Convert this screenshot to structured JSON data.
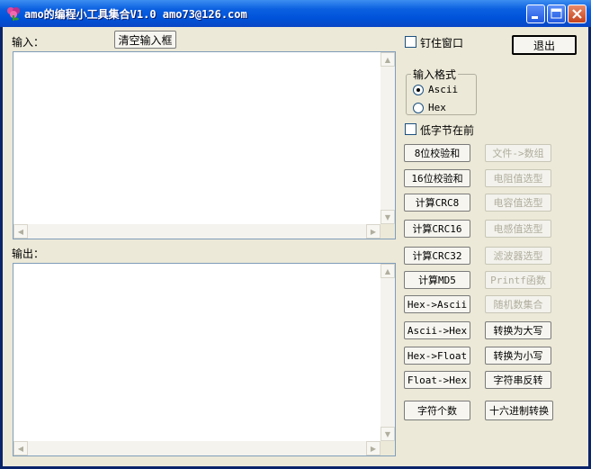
{
  "window": {
    "title": "amo的编程小工具集合V1.0  amo73@126.com"
  },
  "input_section": {
    "label": "输入：",
    "clear_button": "清空输入框"
  },
  "output_section": {
    "label": "输出："
  },
  "options": {
    "pin_window_label": "钉住窗口",
    "pin_window_checked": false,
    "exit_button": "退出",
    "input_format_title": "输入格式",
    "format_options": [
      "Ascii",
      "Hex"
    ],
    "format_selected": "Ascii",
    "low_byte_first_label": "低字节在前",
    "low_byte_first_checked": false
  },
  "left_buttons": [
    "8位校验和",
    "16位校验和",
    "计算CRC8",
    "计算CRC16",
    "计算CRC32",
    "计算MD5",
    "Hex->Ascii",
    "Ascii->Hex",
    "Hex->Float",
    "Float->Hex",
    "字符个数"
  ],
  "right_buttons": [
    {
      "label": "文件->数组",
      "enabled": false
    },
    {
      "label": "电阻值选型",
      "enabled": false
    },
    {
      "label": "电容值选型",
      "enabled": false
    },
    {
      "label": "电感值选型",
      "enabled": false
    },
    {
      "label": "滤波器选型",
      "enabled": false
    },
    {
      "label": "Printf函数",
      "enabled": false
    },
    {
      "label": "随机数集合",
      "enabled": false
    },
    {
      "label": "转换为大写",
      "enabled": true
    },
    {
      "label": "转换为小写",
      "enabled": true
    },
    {
      "label": "字符串反转",
      "enabled": true
    },
    {
      "label": "十六进制转换",
      "enabled": true
    }
  ],
  "colors": {
    "titlebar": "#0052d8",
    "client_bg": "#ece9d8",
    "disabled_text": "#b0ae9e"
  }
}
